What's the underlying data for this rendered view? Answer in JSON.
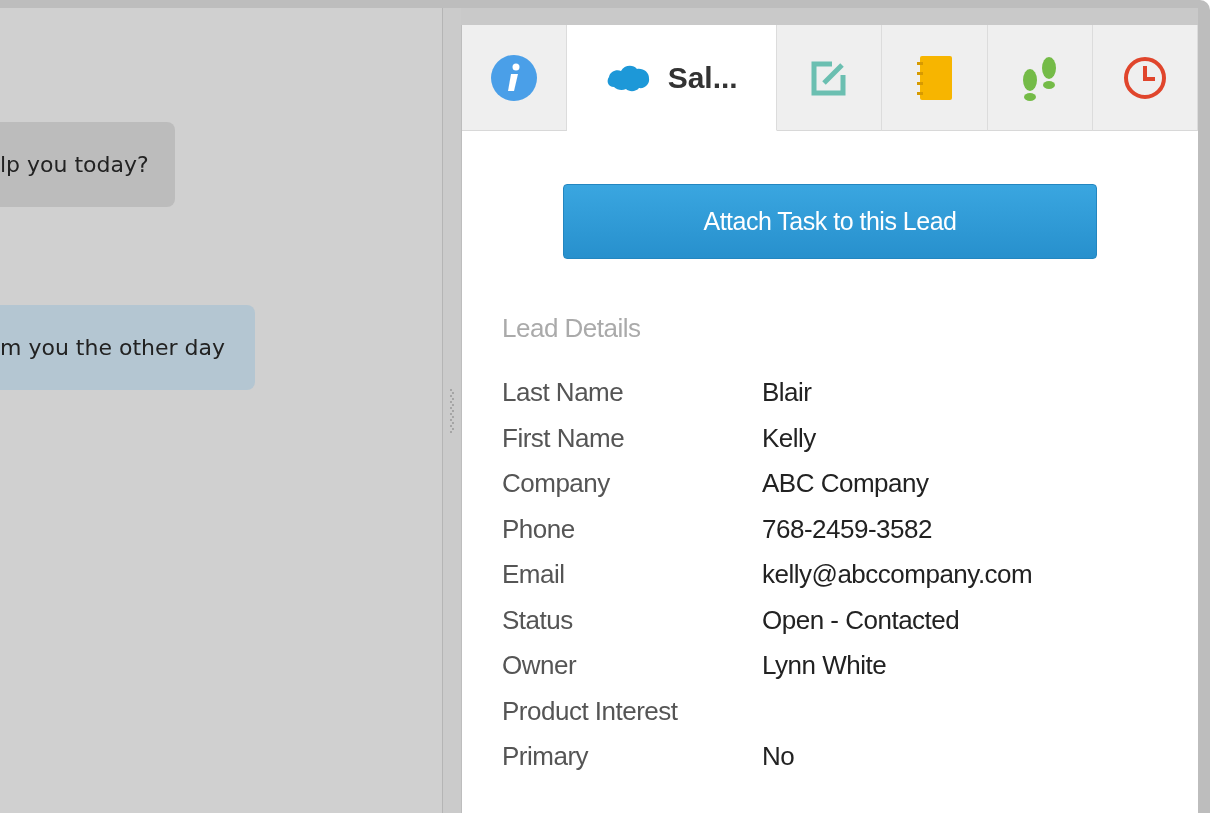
{
  "chat": {
    "messages": [
      {
        "text": "lp you today?",
        "kind": "received"
      },
      {
        "text": "m you the other day",
        "kind": "sent"
      }
    ]
  },
  "tabs": [
    {
      "selected": false
    },
    {
      "label": "Sal...",
      "selected": true
    },
    {
      "selected": false
    },
    {
      "selected": false
    },
    {
      "selected": false
    },
    {
      "selected": false
    }
  ],
  "action_button": "Attach Task to this Lead",
  "section_title": "Lead Details",
  "fields": [
    {
      "label": "Last Name",
      "value": "Blair"
    },
    {
      "label": "First Name",
      "value": "Kelly"
    },
    {
      "label": "Company",
      "value": "ABC Company"
    },
    {
      "label": "Phone",
      "value": "768-2459-3582"
    },
    {
      "label": "Email",
      "value": "kelly@abccompany.com"
    },
    {
      "label": "Status",
      "value": "Open - Contacted"
    },
    {
      "label": "Owner",
      "value": "Lynn White"
    },
    {
      "label": "Product Interest"
    },
    {
      "label": "Primary",
      "value": "No"
    }
  ]
}
